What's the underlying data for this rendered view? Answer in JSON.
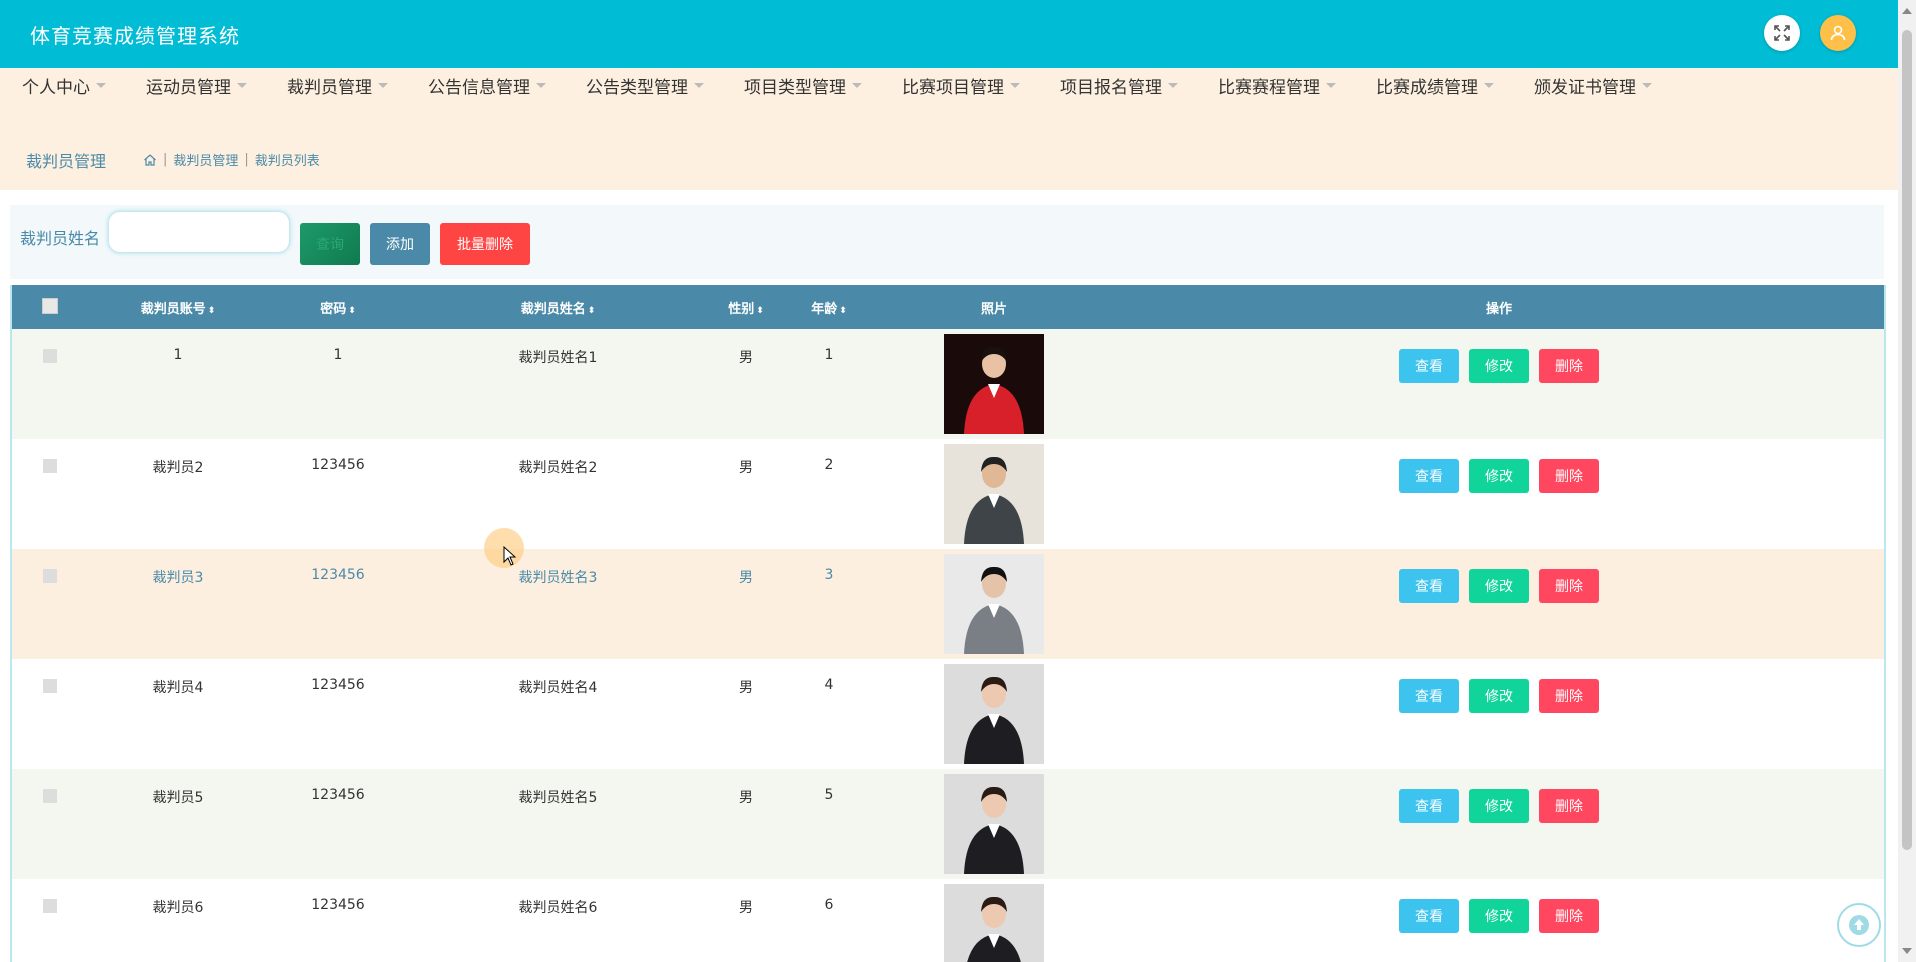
{
  "app": {
    "title": "体育竞赛成绩管理系统"
  },
  "nav": {
    "items": [
      {
        "label": "个人中心"
      },
      {
        "label": "运动员管理"
      },
      {
        "label": "裁判员管理"
      },
      {
        "label": "公告信息管理"
      },
      {
        "label": "公告类型管理"
      },
      {
        "label": "项目类型管理"
      },
      {
        "label": "比赛项目管理"
      },
      {
        "label": "项目报名管理"
      },
      {
        "label": "比赛赛程管理"
      },
      {
        "label": "比赛成绩管理"
      },
      {
        "label": "颁发证书管理"
      }
    ]
  },
  "page": {
    "title": "裁判员管理",
    "breadcrumb": [
      "裁判员管理",
      "裁判员列表"
    ]
  },
  "search": {
    "label": "裁判员姓名",
    "value": "",
    "placeholder": "",
    "query_label": "查询",
    "add_label": "添加",
    "batch_delete_label": "批量删除"
  },
  "table": {
    "columns": [
      "裁判员账号",
      "密码",
      "裁判员姓名",
      "性别",
      "年龄",
      "照片",
      "操作"
    ],
    "rows": [
      {
        "account": "1",
        "password": "1",
        "name": "裁判员姓名1",
        "gender": "男",
        "age": "1"
      },
      {
        "account": "裁判员2",
        "password": "123456",
        "name": "裁判员姓名2",
        "gender": "男",
        "age": "2"
      },
      {
        "account": "裁判员3",
        "password": "123456",
        "name": "裁判员姓名3",
        "gender": "男",
        "age": "3"
      },
      {
        "account": "裁判员4",
        "password": "123456",
        "name": "裁判员姓名4",
        "gender": "男",
        "age": "4"
      },
      {
        "account": "裁判员5",
        "password": "123456",
        "name": "裁判员姓名5",
        "gender": "男",
        "age": "5"
      },
      {
        "account": "裁判员6",
        "password": "123456",
        "name": "裁判员姓名6",
        "gender": "男",
        "age": "6"
      }
    ],
    "actions": {
      "view": "查看",
      "edit": "修改",
      "delete": "删除"
    }
  },
  "colors": {
    "header_bg": "#00bcd4",
    "nav_bg": "#fef0e0",
    "table_header_bg": "#4a8aa8",
    "view": "#3cc4ef",
    "edit": "#10d49a",
    "delete": "#ff4860"
  }
}
